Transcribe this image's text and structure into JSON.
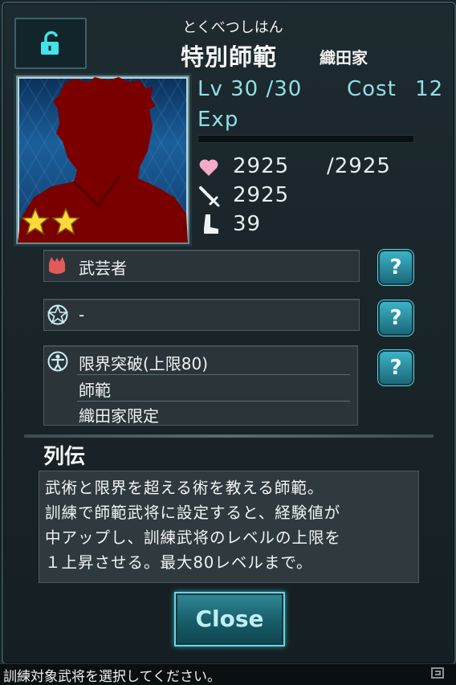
{
  "unit": {
    "reading": "とくべつしはん",
    "name": "特別師範",
    "clan": "織田家",
    "level_label": "Lv",
    "level": "30",
    "level_max": "/30",
    "cost_label": "Cost",
    "cost": "12",
    "exp_label": "Exp",
    "exp_fraction": 0.0,
    "hp": "2925",
    "hp_max": "/2925",
    "attack": "2925",
    "speed": "39",
    "stars": 2
  },
  "skills": [
    {
      "icon": "red-helmet-icon",
      "label": "武芸者"
    },
    {
      "icon": "pentagram-icon",
      "label": "-"
    },
    {
      "icon": "figure-circle-icon",
      "label": "限界突破(上限80)",
      "details": [
        "師範",
        "織田家限定"
      ]
    }
  ],
  "help_label": "?",
  "bio": {
    "title": "列伝",
    "text": "武術と限界を超える術を教える師範。\n訓練で師範武将に設定すると、経験値が\n中アップし、訓練武将のレベルの上限を\n１上昇させる。最大80レベルまで。"
  },
  "close_label": "Close",
  "footer": {
    "message": "訓練対象武将を選択してください。",
    "watermark_icon": "watermark-logo-icon"
  },
  "colors": {
    "accent": "#8ee0e6",
    "help_button": "#2b8fa2",
    "panel": "#1d2a2f"
  }
}
